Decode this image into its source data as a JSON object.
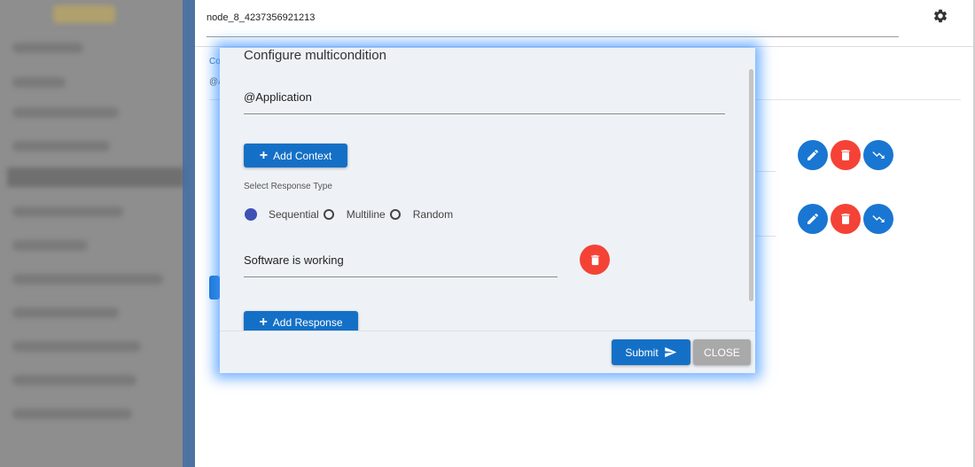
{
  "header": {
    "node_title": "node_8_4237356921213",
    "settings_icon": "gear-icon"
  },
  "background": {
    "label1": "Co",
    "label2": "@A"
  },
  "row_actions": [
    {
      "edit_icon": "pencil-icon",
      "delete_icon": "trash-icon",
      "link_icon": "trend-arrow-icon"
    },
    {
      "edit_icon": "pencil-icon",
      "delete_icon": "trash-icon",
      "link_icon": "trend-arrow-icon"
    }
  ],
  "modal": {
    "title": "Configure multicondition",
    "context_value": "@Application",
    "add_context_label": "Add Context",
    "response_type_label": "Select Response Type",
    "response_types": [
      "Sequential",
      "Multiline",
      "Random"
    ],
    "selected_response_type": "Sequential",
    "response_value": "Software is working",
    "add_response_label": "Add Response",
    "submit_label": "Submit",
    "close_label": "CLOSE"
  },
  "colors": {
    "primary": "#1470c6",
    "danger": "#f44336",
    "radio_selected": "#3f51b5",
    "close_button": "#a9a9a9",
    "modal_bg": "#eef2f6"
  }
}
